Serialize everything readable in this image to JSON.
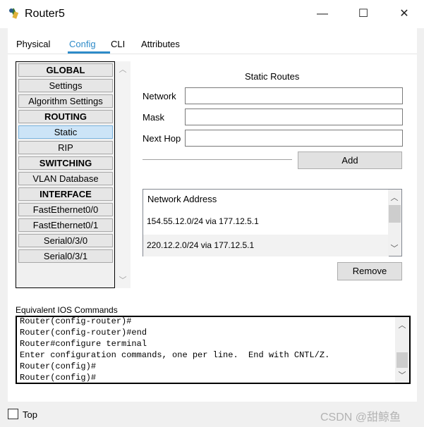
{
  "window": {
    "title": "Router5",
    "minimize": "—",
    "maximize": "☐",
    "close": "✕"
  },
  "tabs": [
    "Physical",
    "Config",
    "CLI",
    "Attributes"
  ],
  "active_tab": "Config",
  "nav": [
    {
      "label": "GLOBAL",
      "header": true
    },
    {
      "label": "Settings"
    },
    {
      "label": "Algorithm Settings"
    },
    {
      "label": "ROUTING",
      "header": true
    },
    {
      "label": "Static",
      "selected": true
    },
    {
      "label": "RIP"
    },
    {
      "label": "SWITCHING",
      "header": true
    },
    {
      "label": "VLAN Database"
    },
    {
      "label": "INTERFACE",
      "header": true
    },
    {
      "label": "FastEthernet0/0"
    },
    {
      "label": "FastEthernet0/1"
    },
    {
      "label": "Serial0/3/0"
    },
    {
      "label": "Serial0/3/1"
    }
  ],
  "static_routes": {
    "title": "Static Routes",
    "network_label": "Network",
    "network_value": "",
    "mask_label": "Mask",
    "mask_value": "",
    "nexthop_label": "Next Hop",
    "nexthop_value": "",
    "add_label": "Add",
    "list_header": "Network Address",
    "routes": [
      "154.55.12.0/24 via 177.12.5.1",
      "220.12.2.0/24 via 177.12.5.1"
    ],
    "remove_label": "Remove"
  },
  "ios": {
    "label": "Equivalent IOS Commands",
    "lines": [
      "Router(config-router)#",
      "Router(config-router)#end",
      "Router#configure terminal",
      "Enter configuration commands, one per line.  End with CNTL/Z.",
      "Router(config)#",
      "Router(config)#"
    ]
  },
  "footer": {
    "top_label": "Top",
    "top_checked": false,
    "watermark": "CSDN @甜鲸鱼"
  },
  "colors": {
    "accent": "#2e8bc9",
    "selected_bg": "#cce4f7"
  }
}
